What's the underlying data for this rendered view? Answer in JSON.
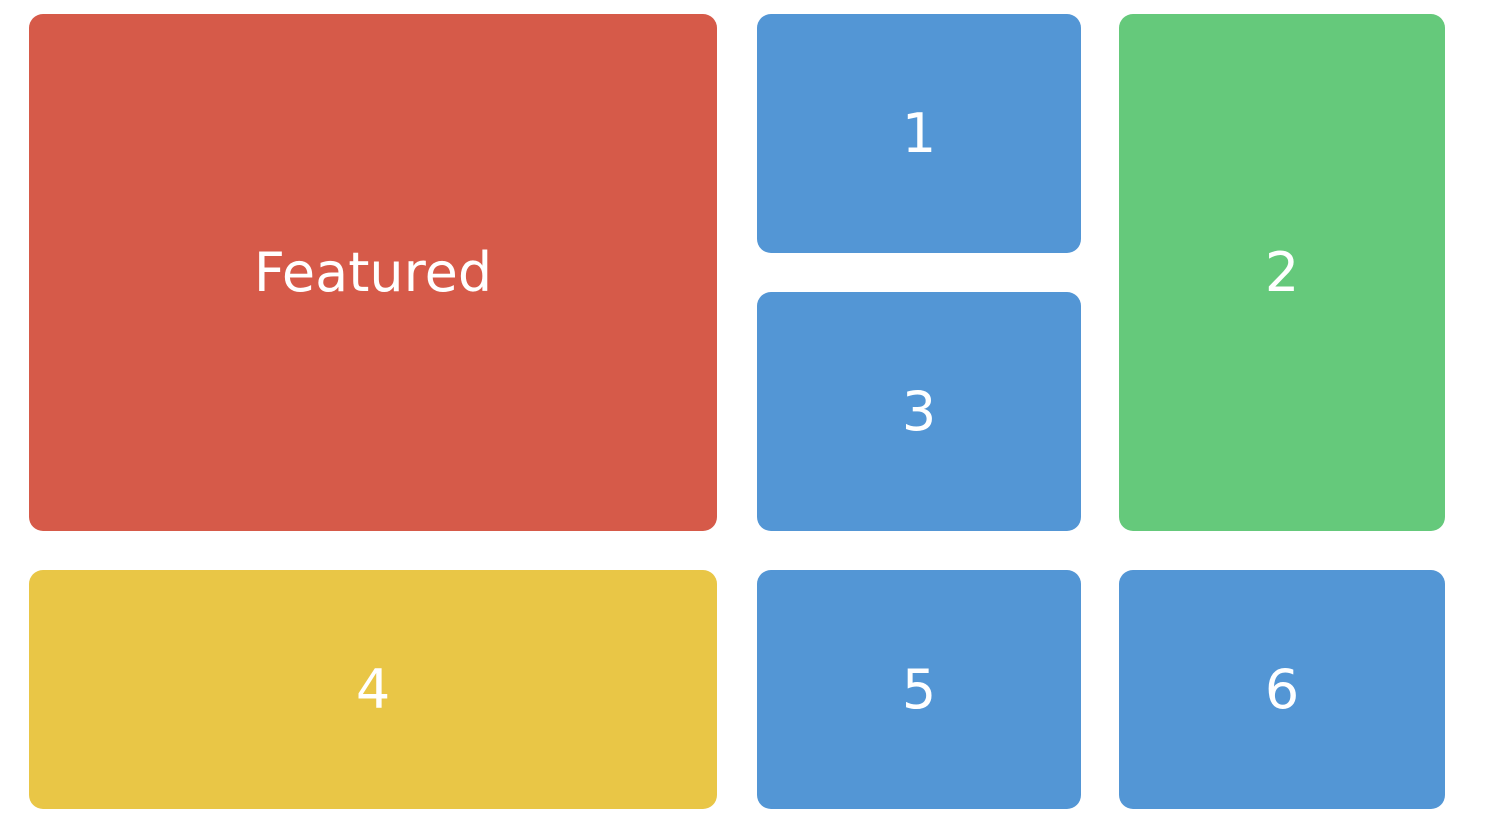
{
  "colors": {
    "featured": "#D65A49",
    "blue": "#5396D5",
    "green": "#65C97B",
    "yellow": "#E9C646",
    "text": "#FFFFFF"
  },
  "tiles": {
    "featured": {
      "label": "Featured",
      "color": "#D65A49"
    },
    "t1": {
      "label": "1",
      "color": "#5396D5"
    },
    "t2": {
      "label": "2",
      "color": "#65C97B"
    },
    "t3": {
      "label": "3",
      "color": "#5396D5"
    },
    "t4": {
      "label": "4",
      "color": "#E9C646"
    },
    "t5": {
      "label": "5",
      "color": "#5396D5"
    },
    "t6": {
      "label": "6",
      "color": "#5396D5"
    }
  }
}
